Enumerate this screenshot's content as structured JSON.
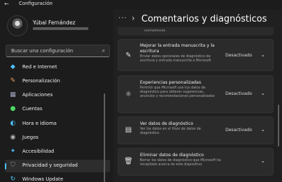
{
  "window": {
    "title": "Configuración",
    "back_icon": "back-arrow-icon"
  },
  "user": {
    "name": "Yúbal Fernández"
  },
  "search": {
    "placeholder": "Buscar una configuración",
    "icon": "search-icon"
  },
  "sidebar": {
    "items": [
      {
        "label": "Red e Internet",
        "icon": "network-icon",
        "color": "#4cc2ff"
      },
      {
        "label": "Personalización",
        "icon": "paintbrush-icon",
        "color": "#f7a35c"
      },
      {
        "label": "Aplicaciones",
        "icon": "apps-icon",
        "color": "#a7a7c7"
      },
      {
        "label": "Cuentas",
        "icon": "person-icon",
        "color": "#4cd964"
      },
      {
        "label": "Hora e idioma",
        "icon": "globe-clock-icon",
        "color": "#4cc2ff"
      },
      {
        "label": "Juegos",
        "icon": "gamepad-icon",
        "color": "#b8b8b8"
      },
      {
        "label": "Accesibilidad",
        "icon": "accessibility-icon",
        "color": "#4cc2ff"
      },
      {
        "label": "Privacidad y seguridad",
        "icon": "shield-icon",
        "color": "#8a8a8a",
        "selected": true
      },
      {
        "label": "Windows Update",
        "icon": "update-icon",
        "color": "#4cc2ff"
      }
    ]
  },
  "main": {
    "title": "Comentarios y diagnósticos",
    "top_text": "normalmente.",
    "cards": [
      {
        "icon": "pen-icon",
        "title_lines": [
          "Mejorar la entrada manuscrita y la",
          "escritura"
        ],
        "desc_lines": [
          "Enviar datos opcionales de diagnóstico de",
          "escritura y entrada manuscrita a Microsoft"
        ],
        "status": "Desactivado"
      },
      {
        "icon": "lightbulb-icon",
        "title_lines": [
          "Experiencias personalizadas"
        ],
        "desc_lines": [
          "Permitir que Microsoft use tus datos de",
          "diagnóstico para obtener sugerencias,",
          "anuncios y recomendaciones personalizados"
        ],
        "status": "Desactivado"
      },
      {
        "icon": "diagnostic-viewer-icon",
        "title_lines": [
          "Ver datos de diagnóstico"
        ],
        "desc_lines": [
          "Ver los datos en el Visor de datos de",
          "diagnóstico"
        ],
        "status": "Desactivado"
      },
      {
        "icon": "trash-icon",
        "title_lines": [
          "Eliminar datos de diagnóstico"
        ],
        "desc_lines": [
          "Borrar los datos de diagnóstico que Microsoft ha",
          "recopilado acerca de este dispositivo"
        ],
        "status": ""
      }
    ]
  }
}
